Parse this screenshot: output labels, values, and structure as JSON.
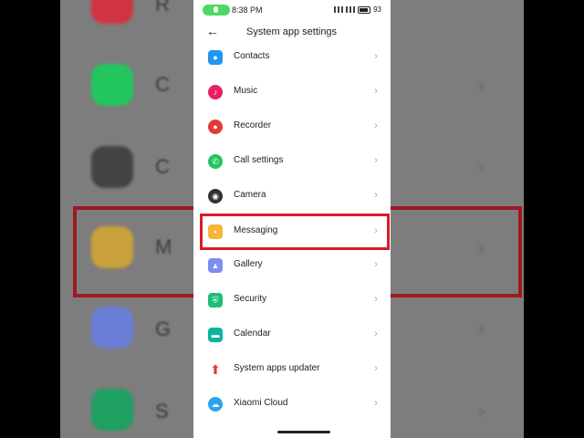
{
  "status_bar": {
    "time": "8:38 PM",
    "battery": "93"
  },
  "header": {
    "title": "System app settings"
  },
  "items": [
    {
      "label": "Contacts",
      "icon": "contacts-icon",
      "color": "#2196f3"
    },
    {
      "label": "Music",
      "icon": "music-icon",
      "color": "#e91e63"
    },
    {
      "label": "Recorder",
      "icon": "recorder-icon",
      "color": "#e53935"
    },
    {
      "label": "Call settings",
      "icon": "phone-icon",
      "color": "#22c55e"
    },
    {
      "label": "Camera",
      "icon": "camera-icon",
      "color": "#333333"
    },
    {
      "label": "Messaging",
      "icon": "message-icon",
      "color": "#f5b63b"
    },
    {
      "label": "Gallery",
      "icon": "gallery-icon",
      "color": "#7b8ff0"
    },
    {
      "label": "Security",
      "icon": "shield-icon",
      "color": "#1fbf7a"
    },
    {
      "label": "Calendar",
      "icon": "calendar-icon",
      "color": "#10b3a0"
    },
    {
      "label": "System apps updater",
      "icon": "update-arrow-icon",
      "color": "#e53935"
    },
    {
      "label": "Xiaomi Cloud",
      "icon": "cloud-icon",
      "color": "#2aa3f0"
    }
  ],
  "colors": {
    "highlight": "#d81b2c",
    "mic_pill": "#4cd964"
  },
  "background": {
    "letters": [
      "R",
      "C",
      "C",
      "M",
      "G",
      "S"
    ]
  }
}
